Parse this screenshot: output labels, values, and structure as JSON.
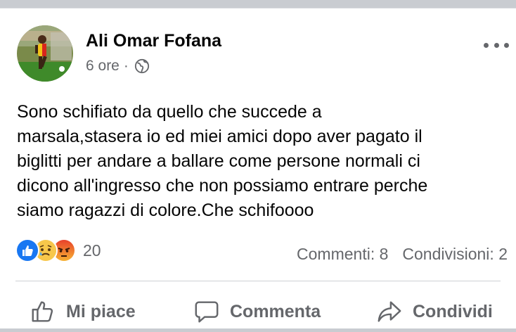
{
  "post": {
    "author": "Ali Omar Fofana",
    "time": "6 ore",
    "separator": "·",
    "privacy_icon": "globe-icon",
    "text_lines": [
      "Sono schifiato da quello che succede a",
      "marsala,stasera io ed miei amici dopo aver pagato il",
      "biglitti per andare a ballare come persone normali ci",
      "dicono all'ingresso che non possiamo entrare perche",
      "siamo ragazzi di colore.Che schifoooo"
    ]
  },
  "reactions": {
    "icons": [
      "like-icon",
      "sad-icon",
      "angry-icon"
    ],
    "count": "20"
  },
  "stats": {
    "comments": "Commenti: 8",
    "shares": "Condivisioni: 2"
  },
  "actions": {
    "like": "Mi piace",
    "comment": "Commenta",
    "share": "Condividi"
  },
  "colors": {
    "secondary_text": "#65676b",
    "like_blue": "#1877f2",
    "angry_red": "#e9710f"
  }
}
